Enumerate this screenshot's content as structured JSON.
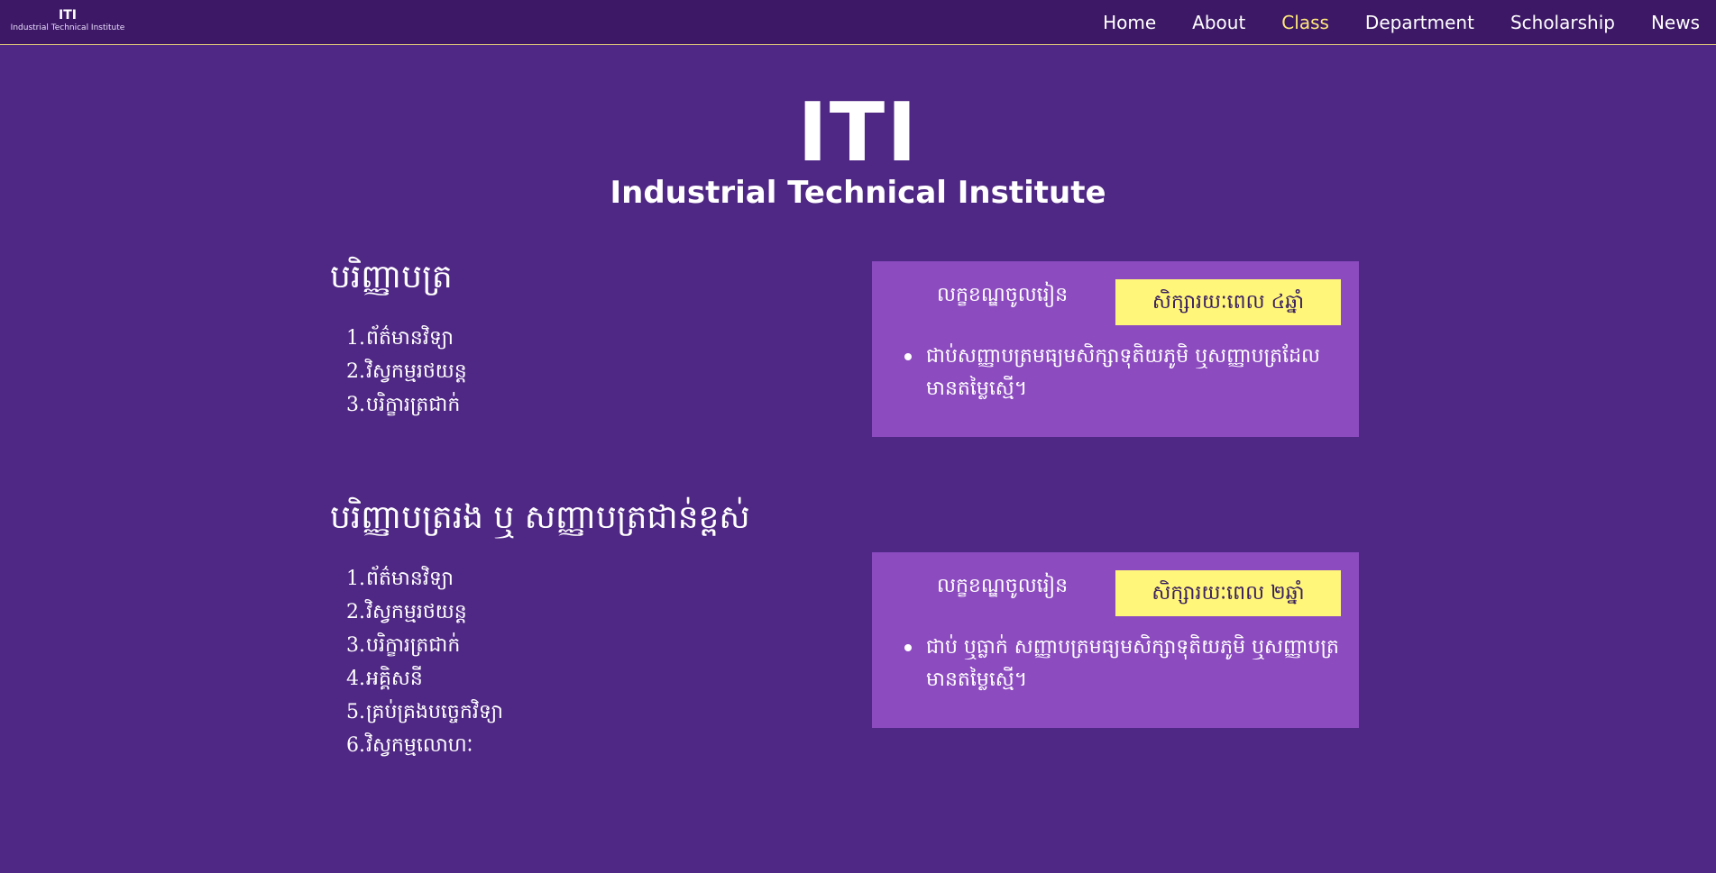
{
  "nav": {
    "brand_title": "ITI",
    "brand_subtitle": "Industrial Technical Institute",
    "links": [
      "Home",
      "About",
      "Class",
      "Department",
      "Scholarship",
      "News"
    ],
    "active": "Class",
    "active_color": "#ffe87a"
  },
  "hero": {
    "title": "ITI",
    "subtitle": "Industrial Technical Institute"
  },
  "sections": [
    {
      "heading": "បរិញ្ញាបត្រ",
      "programs": [
        "ព័ត៌មានវិទ្យា",
        "វិស្វកម្មរថយន្ត",
        "បរិក្ខារត្រជាក់"
      ],
      "card": {
        "label": "លក្ខខណ្ឌចូលរៀន",
        "duration": "សិក្សារយៈពេល ៤ឆ្នាំ",
        "requirement": "ជាប់សញ្ញាបត្រមធ្យមសិក្សាទុតិយភូមិ ឬសញ្ញាបត្រដែលមានតម្លៃស្មើ។"
      }
    },
    {
      "heading": "បរិញ្ញាបត្ររង ឬ សញ្ញាបត្រជាន់ខ្ពស់",
      "programs": [
        "ព័ត៌មានវិទ្យា",
        "វិស្វកម្មរថយន្ត",
        "បរិក្ខារត្រជាក់",
        "អគ្គិសនី",
        "គ្រប់គ្រងបច្ចេកវិទ្យា",
        "វិស្វកម្មលោហៈ"
      ],
      "card": {
        "label": "លក្ខខណ្ឌចូលរៀន",
        "duration": "សិក្សារយៈពេល ២ឆ្នាំ",
        "requirement": "ជាប់ ឬធ្លាក់ សញ្ញាបត្រមធ្យមសិក្សាទុតិយភូមិ ឬសញ្ញាបត្រមានតម្លៃស្មើ។"
      }
    }
  ],
  "colors": {
    "background": "#4f2784",
    "navbar": "#3d1866",
    "card": "#8c4bbf",
    "badge": "#fff67a"
  }
}
